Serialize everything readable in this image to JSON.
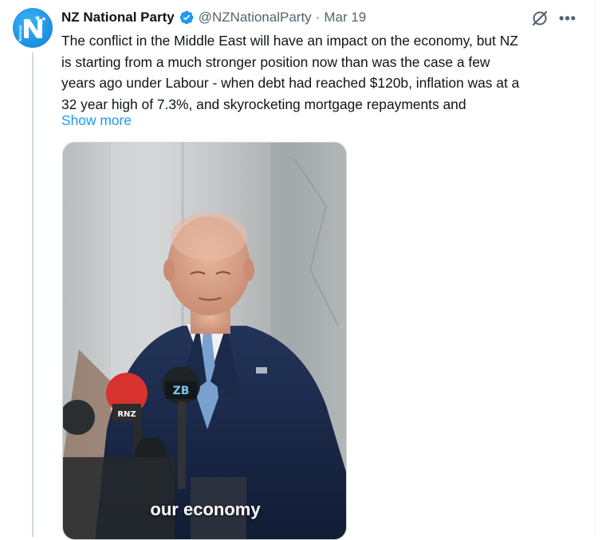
{
  "tweet": {
    "author": {
      "display_name": "NZ National Party",
      "handle": "@NZNationalParty",
      "verified": true,
      "avatar_letter": "N",
      "avatar_word": "National"
    },
    "separator": "·",
    "date": "Mar 19",
    "text_lines": [
      "The conflict in the Middle East will have an impact on the economy, but NZ",
      "is starting from a much stronger position now than was the case a few",
      "years ago under Labour - when debt had reached $120b, inflation was at a",
      "32 year high of 7.3%, and skyrocketing mortgage repayments and"
    ],
    "show_more_label": "Show more",
    "media": {
      "caption": "our economy",
      "mic_labels": [
        "RNZ",
        "ZB"
      ]
    }
  },
  "actions": {
    "grok_icon": "grok-icon",
    "more_icon": "more-options-icon",
    "more_glyph": "•••"
  },
  "colors": {
    "link": "#1d9bf0",
    "secondary_text": "#536471",
    "verified_badge": "#1d9bf0",
    "brand_blue": "#1b8fe0"
  }
}
